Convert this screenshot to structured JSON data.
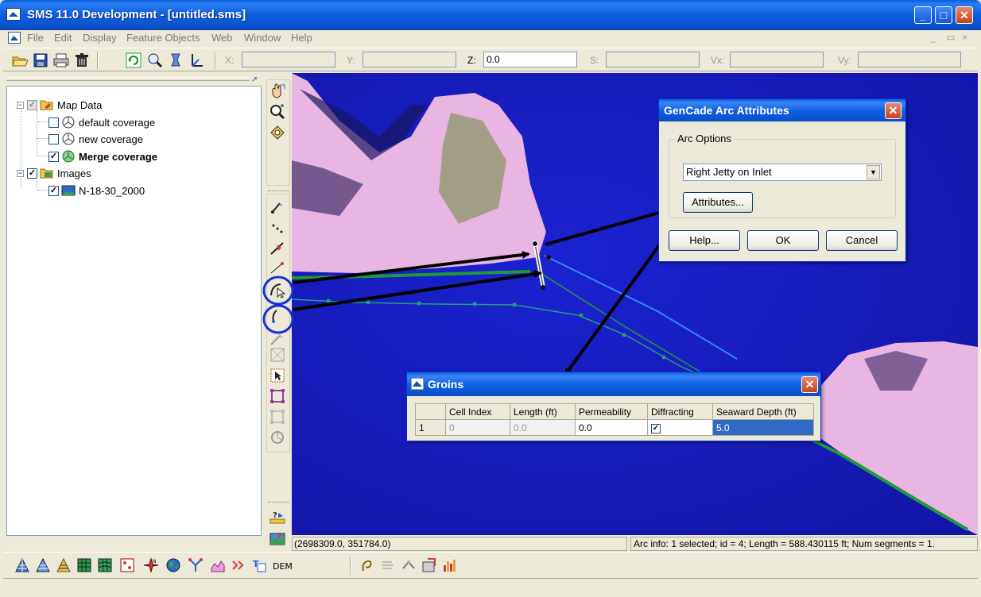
{
  "window": {
    "title": "SMS 11.0 Development - [untitled.sms]",
    "minimize_glyph": "_",
    "maximize_glyph": "□",
    "close_glyph": "✕"
  },
  "menu": {
    "items": [
      "File",
      "Edit",
      "Display",
      "Feature Objects",
      "Web",
      "Window",
      "Help"
    ],
    "mdi_min": "_",
    "mdi_restore": "▭",
    "mdi_close": "×"
  },
  "coords": {
    "x_label": "X:",
    "y_label": "Y:",
    "z_label": "Z:",
    "z_value": "0.0",
    "s_label": "S:",
    "vx_label": "Vx:",
    "vy_label": "Vy:"
  },
  "tree": {
    "map_data": "Map Data",
    "default_coverage": "default coverage",
    "new_coverage": "new coverage",
    "merge_coverage": "Merge coverage",
    "images": "Images",
    "image_item": "N-18-30_2000",
    "check_glyph": "✓",
    "expander_glyph": "−"
  },
  "status": {
    "cursor": "(2698309.0, 351784.0)",
    "arc_info": "Arc info: 1 selected; id = 4; Length = 588.430115 ft; Num segments = 1."
  },
  "bottom_toolbar": {
    "dem_label": "DEM"
  },
  "gencade_dialog": {
    "title": "GenCade Arc Attributes",
    "close_glyph": "✕",
    "group_label": "Arc Options",
    "combo_value": "Right Jetty on Inlet",
    "combo_arrow": "▼",
    "attributes_button": "Attributes...",
    "help_button": "Help...",
    "ok_button": "OK",
    "cancel_button": "Cancel"
  },
  "groins_dialog": {
    "title": "Groins",
    "close_glyph": "✕",
    "columns": [
      "Cell Index",
      "Length (ft)",
      "Permeability",
      "Diffracting",
      "Seaward Depth (ft)"
    ],
    "row": {
      "num": "1",
      "cell_index": "0",
      "length": "0.0",
      "permeability": "0.0",
      "diffracting": "✓",
      "seaward_depth": "5.0"
    }
  },
  "colors": {
    "water": "#1a1fc9",
    "land": "#e9b5e3",
    "annotation_circle": "#1530d8",
    "arrow": "#000000",
    "shoreline": "#1f9a3a",
    "arc_blue": "#2a8cf5"
  }
}
